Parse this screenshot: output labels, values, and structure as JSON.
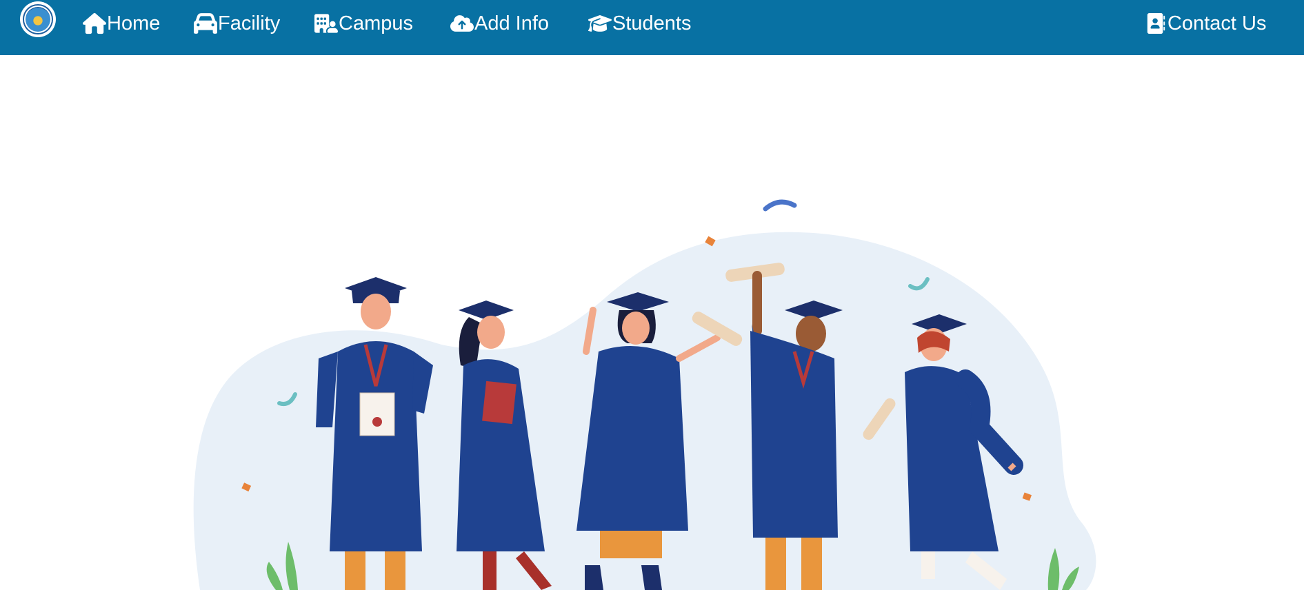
{
  "nav": {
    "logo": {
      "icon": "college-seal-logo"
    },
    "items": [
      {
        "label": "Home",
        "icon": "home-icon"
      },
      {
        "label": "Facility",
        "icon": "car-icon"
      },
      {
        "label": "Campus",
        "icon": "building-user-icon"
      },
      {
        "label": "Add Info",
        "icon": "cloud-upload-icon"
      },
      {
        "label": "Students",
        "icon": "graduation-cap-icon"
      }
    ],
    "contact": {
      "label": "Contact Us",
      "icon": "contact-book-icon"
    },
    "background": "#0871a3"
  },
  "hero": {
    "illustration": "graduates-celebrating-illustration",
    "gown_color": "#1f4390",
    "blob_color": "#e8f0f8"
  }
}
